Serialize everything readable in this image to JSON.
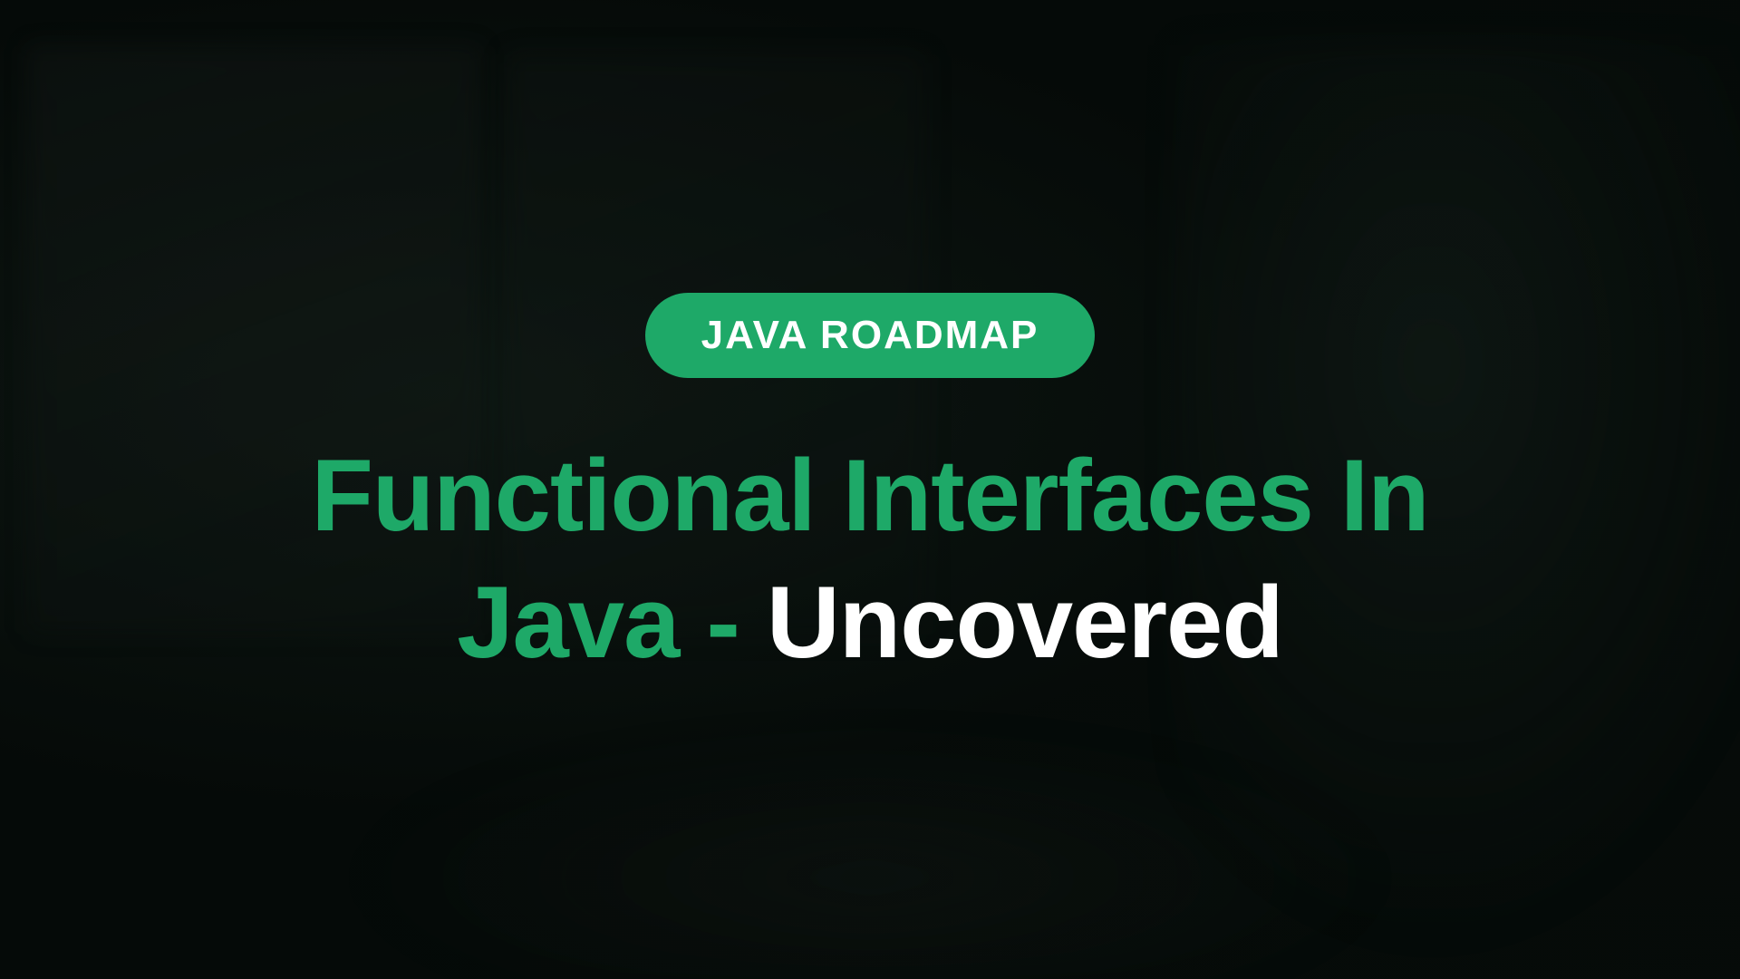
{
  "badge": {
    "label": "JAVA ROADMAP"
  },
  "title": {
    "line1": "Functional Interfaces In",
    "line2_green": "Java - ",
    "line2_white": "Uncovered"
  },
  "colors": {
    "accent_green": "#1ea968",
    "text_white": "#ffffff",
    "background_dark": "#0a0e0d"
  }
}
